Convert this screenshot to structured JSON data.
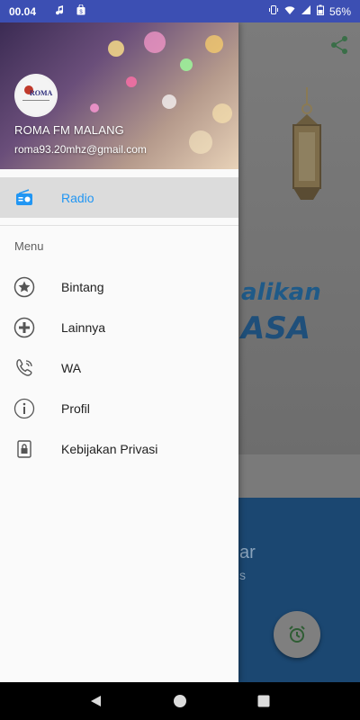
{
  "status_bar": {
    "time": "00.04",
    "battery": "56%",
    "background_color": "#3c4fb3"
  },
  "background_app": {
    "banner_text_line1": "alikan",
    "banner_text_line2": "ASA",
    "panel_text_line1": "ar",
    "panel_text_line2": "s"
  },
  "drawer": {
    "title": "ROMA FM MALANG",
    "email": "roma93.20mhz@gmail.com",
    "logo_text": "ROMA",
    "primary_items": [
      {
        "label": "Radio",
        "icon": "radio-icon",
        "active": true
      }
    ],
    "section_label": "Menu",
    "items": [
      {
        "label": "Bintang",
        "icon": "star-icon"
      },
      {
        "label": "Lainnya",
        "icon": "plus-circle-icon"
      },
      {
        "label": "WA",
        "icon": "phone-icon"
      },
      {
        "label": "Profil",
        "icon": "info-icon"
      },
      {
        "label": "Kebijakan Privasi",
        "icon": "lock-icon"
      }
    ],
    "accent_color": "#2196f3"
  }
}
